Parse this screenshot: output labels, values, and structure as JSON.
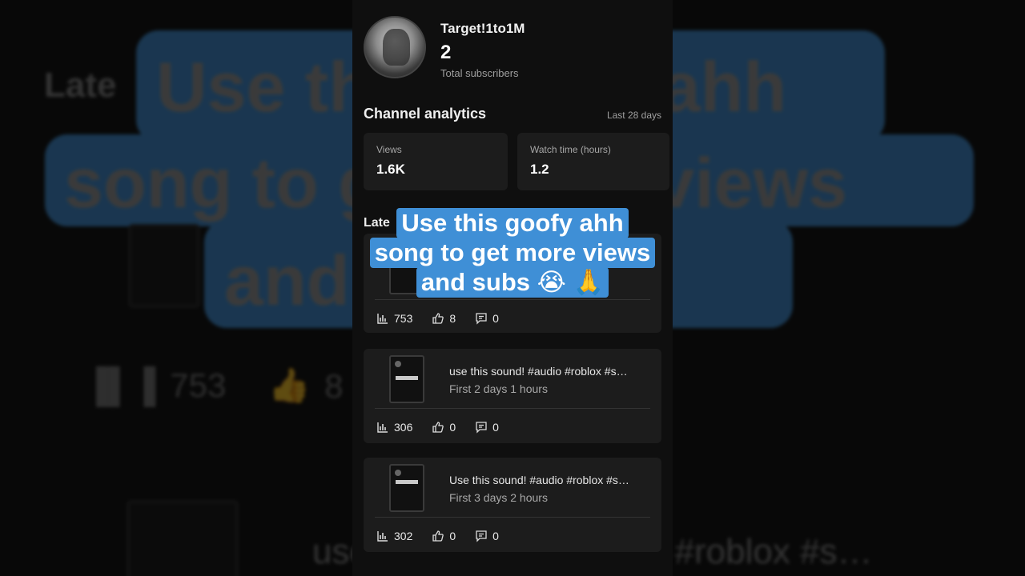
{
  "channel": {
    "name": "Target!1to1M",
    "subscriber_count": "2",
    "subscriber_label": "Total subscribers"
  },
  "analytics": {
    "title": "Channel analytics",
    "range": "Last 28 days",
    "views_label": "Views",
    "views_value": "1.6K",
    "watch_label": "Watch time (hours)",
    "watch_value": "1.2"
  },
  "latest": {
    "label": "Late"
  },
  "caption": {
    "line1": "Use this goofy ahh",
    "line2": "song to get more views",
    "line3": "and subs 😭 🙏"
  },
  "videos": [
    {
      "title": "",
      "subtitle": "",
      "views": "753",
      "likes": "8",
      "comments": "0"
    },
    {
      "title": "use this sound! #audio #roblox #s…",
      "subtitle": "First 2 days 1 hours",
      "views": "306",
      "likes": "0",
      "comments": "0"
    },
    {
      "title": "Use this sound! #audio #roblox #s…",
      "subtitle": "First 3 days 2 hours",
      "views": "302",
      "likes": "0",
      "comments": "0"
    }
  ],
  "background": {
    "late": "Late",
    "big_line1": "Use this goofy ahh",
    "big_line2": "song to get more views",
    "big_line3": "and subs",
    "views": "753",
    "likes": "8",
    "bottom_text": "use this sound! #audio #roblox #s…"
  },
  "colors": {
    "caption_bg": "#3f8fd6",
    "card_bg": "#1c1c1c",
    "panel_bg": "#0f0f0f"
  }
}
